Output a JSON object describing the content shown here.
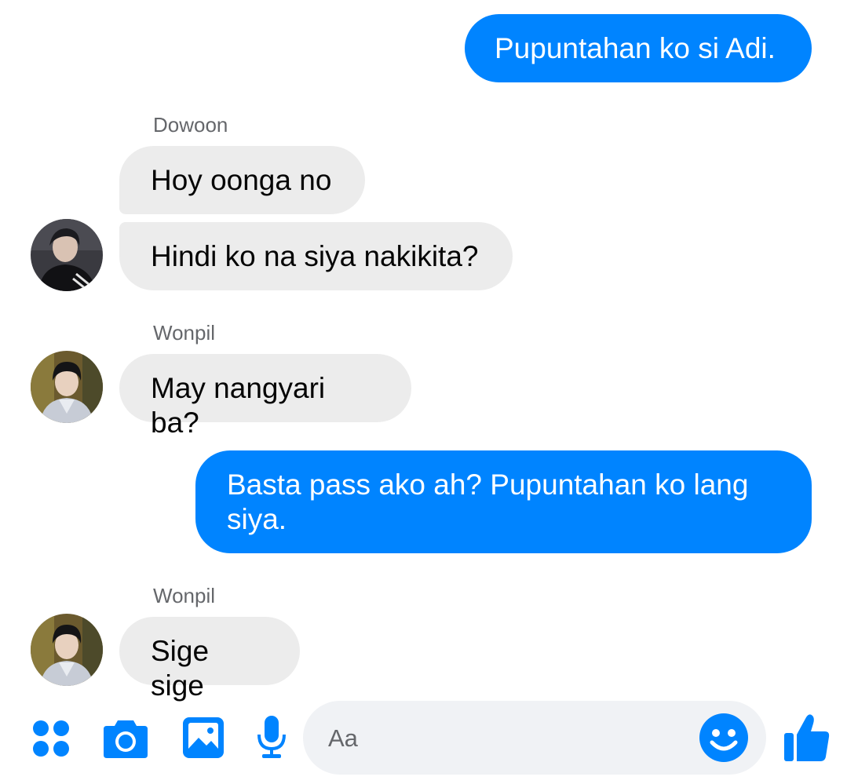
{
  "messages": [
    {
      "text": "Pupuntahan ko si Adi."
    },
    {
      "sender": "Dowoon",
      "text": "Hoy oonga no"
    },
    {
      "text": "Hindi ko na siya nakikita?"
    },
    {
      "sender": "Wonpil",
      "text": "May nangyari ba?"
    },
    {
      "text": "Basta pass ako ah? Pupuntahan ko lang siya."
    },
    {
      "sender": "Wonpil",
      "text": "Sige sige"
    }
  ],
  "composer": {
    "placeholder": "Aa",
    "icons": [
      "apps-icon",
      "camera-icon",
      "image-icon",
      "microphone-icon",
      "emoji-icon",
      "thumbs-up-icon"
    ]
  },
  "colors": {
    "accent": "#0084ff",
    "incoming_bubble": "#ececec"
  }
}
